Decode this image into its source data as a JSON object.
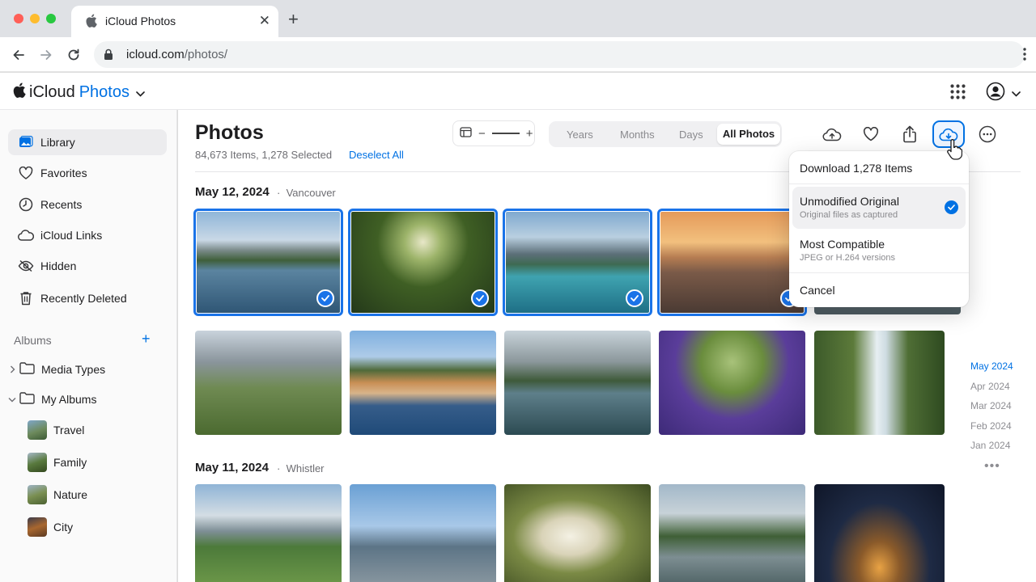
{
  "browser": {
    "tab_title": "iCloud Photos",
    "url_host": "icloud.com",
    "url_path": "/photos/"
  },
  "app": {
    "brand_icloud": "iCloud",
    "brand_photos": "Photos"
  },
  "sidebar": {
    "items": [
      {
        "label": "Library",
        "icon": "library-icon"
      },
      {
        "label": "Favorites",
        "icon": "heart-icon"
      },
      {
        "label": "Recents",
        "icon": "clock-icon"
      },
      {
        "label": "iCloud Links",
        "icon": "cloud-icon"
      },
      {
        "label": "Hidden",
        "icon": "eye-slash-icon"
      },
      {
        "label": "Recently Deleted",
        "icon": "trash-icon"
      }
    ],
    "albums_heading": "Albums",
    "add_label": "+",
    "media_types": "Media Types",
    "my_albums": "My Albums",
    "albums": [
      "Travel",
      "Family",
      "Nature",
      "City"
    ]
  },
  "main": {
    "title": "Photos",
    "subtitle": "84,673 Items, 1,278 Selected",
    "deselect": "Deselect All",
    "views": [
      "Years",
      "Months",
      "Days",
      "All Photos"
    ],
    "active_view": "All Photos",
    "sections": [
      {
        "date": "May 12, 2024",
        "location": "Vancouver"
      },
      {
        "date": "May 11, 2024",
        "location": "Whistler"
      }
    ],
    "timeline": [
      "May 2024",
      "Apr 2024",
      "Mar 2024",
      "Feb 2024",
      "Jan 2024"
    ],
    "timeline_more": "•••"
  },
  "download_menu": {
    "heading": "Download 1,278 Items",
    "options": [
      {
        "title": "Unmodified Original",
        "desc": "Original files as captured",
        "selected": true
      },
      {
        "title": "Most Compatible",
        "desc": "JPEG or H.264 versions",
        "selected": false
      }
    ],
    "cancel": "Cancel"
  },
  "colors": {
    "accent": "#0071e3",
    "selection": "#1a73e8"
  }
}
